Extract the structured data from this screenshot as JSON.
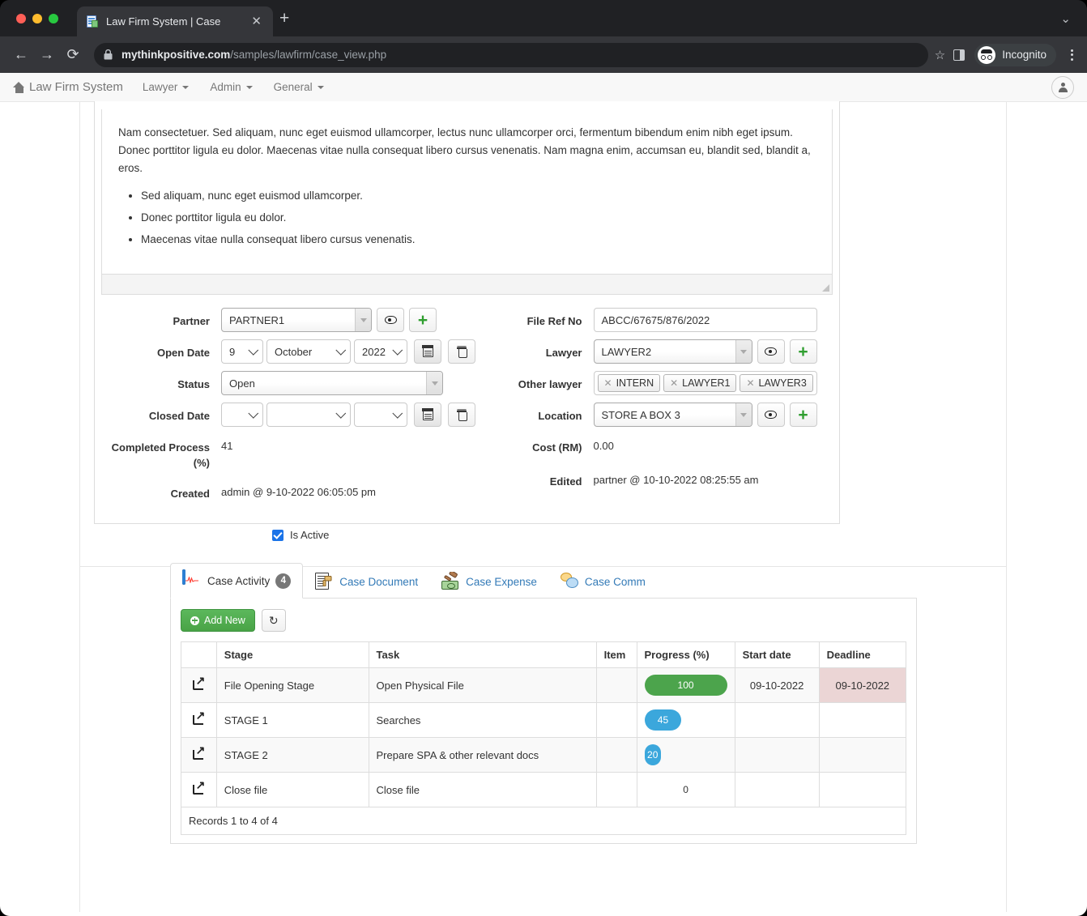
{
  "browser": {
    "tab_title": "Law Firm System | Case",
    "tab_close": "✕",
    "new_tab": "+",
    "window_chevron": "⌄",
    "back": "←",
    "forward": "→",
    "reload": "⟳",
    "url_domain": "mythinkpositive.com",
    "url_path": "/samples/lawfirm/case_view.php",
    "star": "☆",
    "incognito_label": "Incognito"
  },
  "navbar": {
    "brand": "Law Firm System",
    "links": [
      {
        "label": "Lawyer"
      },
      {
        "label": "Admin"
      },
      {
        "label": "General"
      }
    ]
  },
  "description": {
    "paragraph": "Nam consectetuer. Sed aliquam, nunc eget euismod ullamcorper, lectus nunc ullamcorper orci, fermentum bibendum enim nibh eget ipsum. Donec porttitor ligula eu dolor. Maecenas vitae nulla consequat libero cursus venenatis. Nam magna enim, accumsan eu, blandit sed, blandit a, eros.",
    "bullets": [
      "Sed aliquam, nunc eget euismod ullamcorper.",
      "Donec porttitor ligula eu dolor.",
      "Maecenas vitae nulla consequat libero cursus venenatis."
    ]
  },
  "form": {
    "left": {
      "partner_label": "Partner",
      "partner_value": "PARTNER1",
      "open_date_label": "Open Date",
      "open_day": "9",
      "open_month": "October",
      "open_year": "2022",
      "status_label": "Status",
      "status_value": "Open",
      "closed_date_label": "Closed Date",
      "closed_day": "",
      "closed_month": "",
      "closed_year": "",
      "completed_label": "Completed Process (%)",
      "completed_value": "41",
      "created_label": "Created",
      "created_value": "admin @ 9-10-2022 06:05:05 pm"
    },
    "right": {
      "file_ref_label": "File Ref No",
      "file_ref_value": "ABCC/67675/876/2022",
      "lawyer_label": "Lawyer",
      "lawyer_value": "LAWYER2",
      "other_lawyer_label": "Other lawyer",
      "other_lawyers": [
        "INTERN",
        "LAWYER1",
        "LAWYER3"
      ],
      "location_label": "Location",
      "location_value": "STORE A BOX 3",
      "cost_label": "Cost (RM)",
      "cost_value": "0.00",
      "edited_label": "Edited",
      "edited_value": "partner @ 10-10-2022 08:25:55 am"
    },
    "is_active_label": "Is Active",
    "is_active_checked": true
  },
  "tabs": [
    {
      "label": "Case Activity",
      "icon": "activity-monitor-icon",
      "badge": "4",
      "active": true
    },
    {
      "label": "Case Document",
      "icon": "document-gavel-icon",
      "badge": "",
      "active": false
    },
    {
      "label": "Case Expense",
      "icon": "gavel-money-icon",
      "badge": "",
      "active": false
    },
    {
      "label": "Case Comm",
      "icon": "speech-bubbles-icon",
      "badge": "",
      "active": false
    }
  ],
  "toolbar": {
    "add_new": "Add New",
    "refresh_icon": "↻"
  },
  "table": {
    "headers": [
      "",
      "Stage",
      "Task",
      "Item",
      "Progress (%)",
      "Start date",
      "Deadline"
    ],
    "rows": [
      {
        "stage": "File Opening Stage",
        "task": "Open Physical File",
        "item": "",
        "progress": "100",
        "progress_pct": 100,
        "progress_color": "#4ca44c",
        "start_date": "09-10-2022",
        "deadline": "09-10-2022",
        "deadline_overdue": true
      },
      {
        "stage": "STAGE 1",
        "task": "Searches",
        "item": "",
        "progress": "45",
        "progress_pct": 45,
        "progress_color": "#3ba7dc",
        "start_date": "",
        "deadline": "",
        "deadline_overdue": false
      },
      {
        "stage": "STAGE 2",
        "task": "Prepare SPA & other relevant docs",
        "item": "",
        "progress": "20",
        "progress_pct": 20,
        "progress_color": "#3ba7dc",
        "start_date": "",
        "deadline": "",
        "deadline_overdue": false
      },
      {
        "stage": "Close file",
        "task": "Close file",
        "item": "",
        "progress": "0",
        "progress_pct": 0,
        "progress_color": "",
        "start_date": "",
        "deadline": "",
        "deadline_overdue": false
      }
    ],
    "footer": "Records 1 to 4 of 4"
  },
  "colors": {
    "accent_link": "#337ab7",
    "success": "#4ca44c",
    "info": "#3ba7dc",
    "danger_bg": "#ebd5d5",
    "checkbox": "#1a73e8"
  }
}
